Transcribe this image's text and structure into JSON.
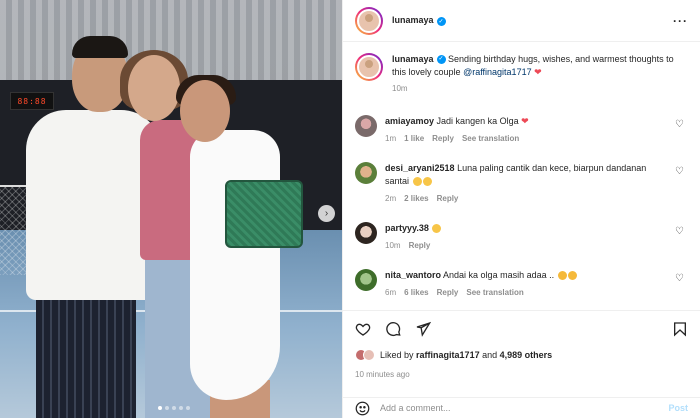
{
  "post": {
    "username": "lunamaya",
    "caption_text": "Sending birthday hugs, wishes, and warmest thoughts to this lovely couple",
    "caption_mention": "@raffinagita1717",
    "caption_time": "10m",
    "photo_scoreboard": "88:88"
  },
  "comments": [
    {
      "username": "amiayamoy",
      "text": "Jadi kangen ka Olga",
      "time": "1m",
      "likes": "1 like",
      "reply": "Reply",
      "translate": "See translation"
    },
    {
      "username": "desi_aryani2518",
      "text": "Luna paling cantik dan kece, biarpun dandanan santai",
      "time": "2m",
      "likes": "2 likes",
      "reply": "Reply",
      "translate": ""
    },
    {
      "username": "partyyy.38",
      "text": "",
      "time": "10m",
      "likes": "",
      "reply": "Reply",
      "translate": ""
    },
    {
      "username": "nita_wantoro",
      "text": "Andai ka olga masih adaa ..",
      "time": "6m",
      "likes": "6 likes",
      "reply": "Reply",
      "translate": "See translation"
    }
  ],
  "likes_bar": {
    "prefix": "Liked by",
    "user": "raffinagita1717",
    "and": "and",
    "others": "4,989 others"
  },
  "post_time": "10 minutes ago",
  "add_comment": {
    "placeholder": "Add a comment...",
    "post_label": "Post"
  },
  "colors": {
    "accent": "#0095f6",
    "heart": "#ed4956",
    "muted": "#8e8e8e",
    "mention": "#00376b"
  }
}
